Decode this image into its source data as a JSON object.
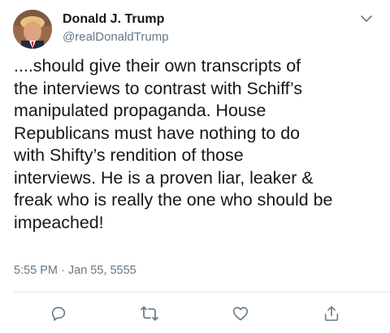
{
  "user": {
    "display_name": "Donald J. Trump",
    "handle": "@realDonaldTrump"
  },
  "tweet": {
    "text": "....should give their own transcripts of\nthe interviews to contrast with Schiff’s\nmanipulated propaganda. House\nRepublicans must have nothing to do\nwith Shifty’s rendition of those\ninterviews. He is a proven liar, leaker &\nfreak who is really the one who should be\nimpeached!",
    "timestamp": "5:55 PM · Jan 55, 5555"
  },
  "actions": [
    {
      "name": "reply",
      "icon": "reply-icon"
    },
    {
      "name": "retweet",
      "icon": "retweet-icon"
    },
    {
      "name": "like",
      "icon": "heart-icon"
    },
    {
      "name": "share",
      "icon": "share-icon"
    }
  ],
  "colors": {
    "text": "#14171a",
    "secondary": "#657786",
    "divider": "#e1e8ed",
    "icon": "#657786"
  }
}
